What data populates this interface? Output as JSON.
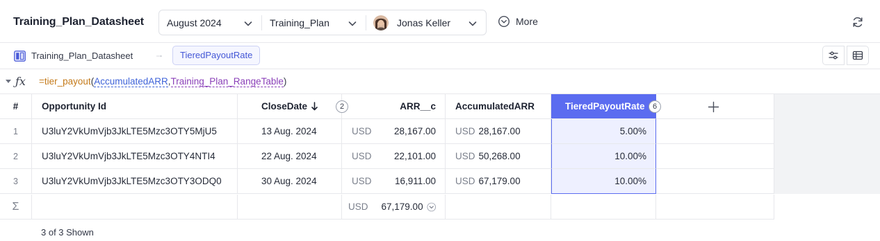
{
  "header": {
    "title": "Training_Plan_Datasheet",
    "filters": {
      "period": "August 2024",
      "plan": "Training_Plan",
      "user": "Jonas Keller"
    },
    "more_label": "More"
  },
  "subbar": {
    "datasheet_name": "Training_Plan_Datasheet",
    "variable_chip": "TieredPayoutRate"
  },
  "formula": {
    "eq": "=",
    "fn": "tier_payout",
    "open": "(",
    "arg1": "AccumulatedARR",
    "comma": ",",
    "arg2": "Training_Plan_RangeTable",
    "close": ")"
  },
  "table": {
    "columns": {
      "index": "#",
      "opportunity": "Opportunity Id",
      "close_date": "CloseDate",
      "close_date_badge": "2",
      "arr": "ARR__c",
      "accumulated": "AccumulatedARR",
      "tiered": "TieredPayoutRate",
      "tiered_badge": "6"
    },
    "rows": [
      {
        "num": "1",
        "opportunity": "U3luY2VkUmVjb3JkLTE5Mzc3OTY5MjU5",
        "close_date": "13 Aug. 2024",
        "arr_cur": "USD",
        "arr": "28,167.00",
        "acc_cur": "USD",
        "acc": "28,167.00",
        "rate": "5.00%"
      },
      {
        "num": "2",
        "opportunity": "U3luY2VkUmVjb3JkLTE5Mzc3OTY4NTI4",
        "close_date": "22 Aug. 2024",
        "arr_cur": "USD",
        "arr": "22,101.00",
        "acc_cur": "USD",
        "acc": "50,268.00",
        "rate": "10.00%"
      },
      {
        "num": "3",
        "opportunity": "U3luY2VkUmVjb3JkLTE5Mzc3OTY3ODQ0",
        "close_date": "30 Aug. 2024",
        "arr_cur": "USD",
        "arr": "16,911.00",
        "acc_cur": "USD",
        "acc": "67,179.00",
        "rate": "10.00%"
      }
    ],
    "summary": {
      "sigma": "Σ",
      "arr_cur": "USD",
      "arr_total": "67,179.00"
    }
  },
  "footer": {
    "shown": "3 of 3 Shown"
  },
  "colors": {
    "accent": "#5b6cf0",
    "accent_light": "#eef0ff",
    "chip_text": "#4457d6"
  },
  "icons": [
    "chevron-down-icon",
    "avatar",
    "more-circle-icon",
    "refresh-icon",
    "datasheet-icon",
    "settings-sliders-icon",
    "table-icon",
    "fx-icon",
    "sort-down-icon",
    "plus-icon"
  ]
}
